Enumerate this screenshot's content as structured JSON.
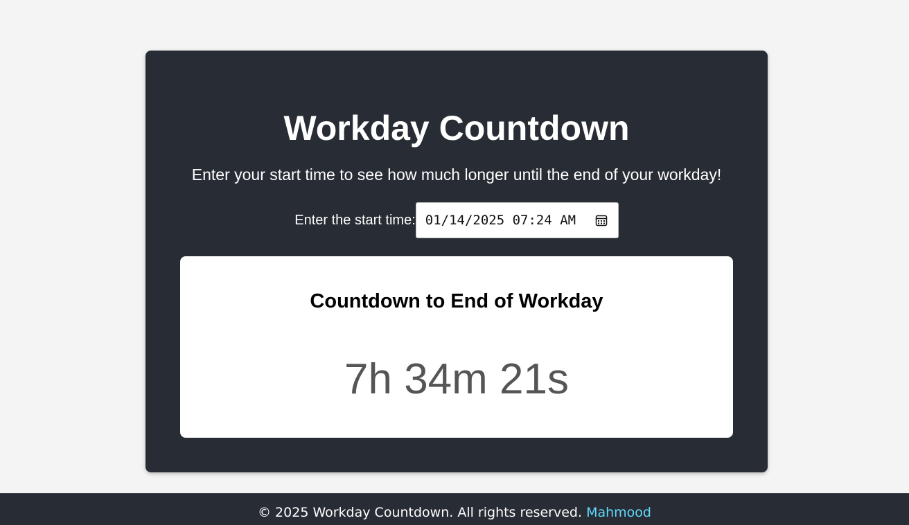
{
  "header": {
    "title": "Workday Countdown",
    "subtitle": "Enter your start time to see how much longer until the end of your workday!"
  },
  "start_time": {
    "label": "Enter the start time:",
    "value": "01/14/2025 07:24 AM",
    "icon": "calendar-icon"
  },
  "countdown": {
    "heading": "Countdown to End of Workday",
    "value": "7h 34m 21s"
  },
  "footer": {
    "text": "© 2025 Workday Countdown. All rights reserved.",
    "link_label": "Mahmood"
  },
  "colors": {
    "page_background": "#f4f4f4",
    "card_background": "#282c34",
    "countdown_text": "#555555",
    "link": "#61dafb"
  }
}
